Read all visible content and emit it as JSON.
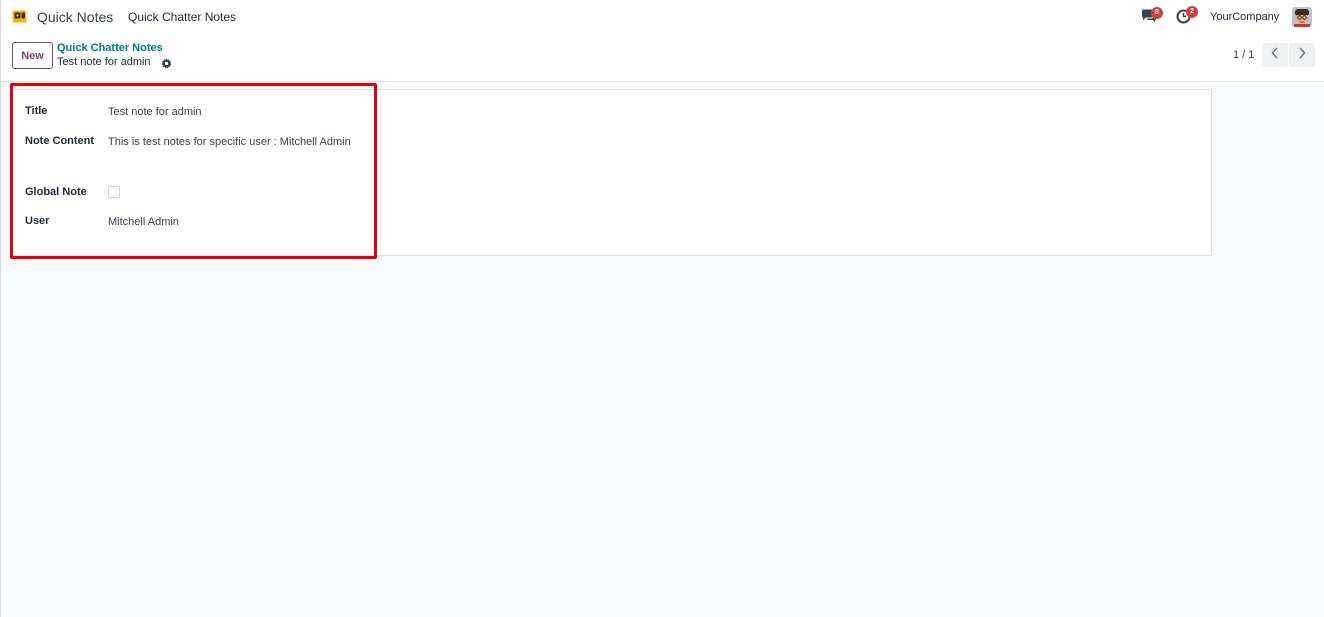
{
  "navbar": {
    "app_name": "Quick Notes",
    "menu_item": "Quick Chatter Notes",
    "chat_badge": "8",
    "activity_badge": "2",
    "company": "YourCompany"
  },
  "control_panel": {
    "new_label": "New",
    "breadcrumb_parent": "Quick Chatter Notes",
    "breadcrumb_current": "Test note for admin",
    "pager_value": "1 / 1"
  },
  "form": {
    "title_label": "Title",
    "title_value": "Test note for admin",
    "content_label": "Note Content",
    "content_value": "This is test notes for specific user : Mitchell Admin",
    "global_label": "Global Note",
    "global_checked": false,
    "user_label": "User",
    "user_value": "Mitchell Admin"
  },
  "colors": {
    "brand": "#714b67",
    "link": "#017e84",
    "badge": "#d23f3a",
    "highlight": "#e3000f"
  },
  "icons": [
    "app-logo-icon",
    "chat-icon",
    "activity-clock-icon",
    "gear-icon",
    "chevron-left-icon",
    "chevron-right-icon"
  ]
}
